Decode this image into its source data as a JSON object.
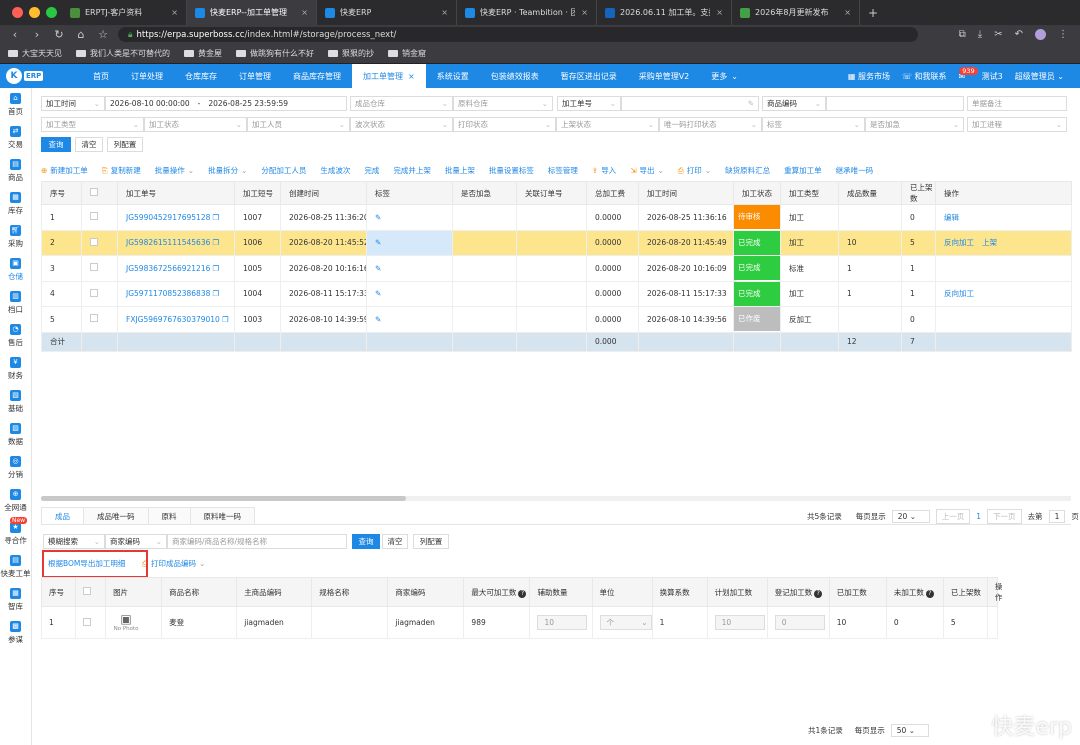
{
  "browser": {
    "tabs": [
      {
        "label": "ERPTJ-客户资料",
        "color": "#4a8f3c",
        "active": false
      },
      {
        "label": "快麦ERP--加工单管理",
        "color": "#1e88e5",
        "active": true
      },
      {
        "label": "快麦ERP",
        "color": "#1e88e5",
        "active": false
      },
      {
        "label": "快麦ERP · Teambition · 团队",
        "color": "#1e88e5",
        "active": false
      },
      {
        "label": "2026.06.11 加工单。支持成品",
        "color": "#1565c0",
        "active": false
      },
      {
        "label": "2026年8月更新发布",
        "color": "#43a047",
        "active": false
      }
    ],
    "url_host": "https://erpa.superboss.cc",
    "url_path": "/index.html#/storage/process_next/",
    "bookmarks": [
      "大宝天天见",
      "我们人类是不可替代的",
      "黄金屋",
      "做跳狗有什么不好",
      "狠狠的抄",
      "销金窟"
    ]
  },
  "appnav": {
    "logo": "K",
    "logo_tag": "ERP",
    "items": [
      "首页",
      "订单处理",
      "仓库库存",
      "订单管理",
      "商品库存管理",
      "加工单管理",
      "系统设置",
      "包装绩效报表",
      "暂存区进出记录",
      "采购单管理V2",
      "更多"
    ],
    "active_index": 5,
    "right": {
      "market": "服务市场",
      "contact": "和我联系",
      "msg_count": "939",
      "user1": "测试3",
      "user2": "超级管理员"
    }
  },
  "sidebar": [
    "首页",
    "交易",
    "商品",
    "库存",
    "采购",
    "仓储",
    "档口",
    "售后",
    "财务",
    "基础",
    "数据",
    "分销",
    "全网通",
    "寻合作",
    "快麦工单",
    "智库",
    "参谋"
  ],
  "sidebar_new": "New",
  "filters": {
    "time_type": "加工时间",
    "date_start": "2026-08-10 00:00:00",
    "date_sep": "-",
    "date_end": "2026-08-25 23:59:59",
    "ph_finished_wh": "成品仓库",
    "ph_raw_wh": "原料仓库",
    "order_no_type": "加工单号",
    "code_type": "商品编码",
    "ph_remark": "单据备注",
    "ph_type": "加工类型",
    "ph_status": "加工状态",
    "ph_worker": "加工人员",
    "ph_wave": "波次状态",
    "ph_print": "打印状态",
    "ph_shelf": "上架状态",
    "ph_unique": "唯一码打印状态",
    "ph_tag": "标签",
    "ph_urgent": "是否加急",
    "ph_progress": "加工进程",
    "btn_query": "查询",
    "btn_clear": "清空",
    "btn_columns": "列配置"
  },
  "actions": [
    "新建加工单",
    "复制新建",
    "批量操作",
    "批量拆分",
    "分配加工人员",
    "生成波次",
    "完成",
    "完成并上架",
    "批量上架",
    "批量设置标签",
    "标签管理",
    "导入",
    "导出",
    "打印",
    "缺货原料汇总",
    "重算加工单",
    "继承唯一码"
  ],
  "main_table": {
    "headers": [
      "序号",
      "",
      "加工单号",
      "加工短号",
      "创建时间",
      "标签",
      "是否加急",
      "关联订单号",
      "总加工费",
      "加工时间",
      "加工状态",
      "加工类型",
      "成品数量",
      "已上架数",
      "操作"
    ],
    "rows": [
      {
        "idx": "1",
        "no": "JG5990452917695128",
        "short": "1007",
        "created": "2026-08-25 11:36:20",
        "fee": "0.0000",
        "ptime": "2026-08-25 11:36:16",
        "status": "待审核",
        "status_color": "#fb8c00",
        "type": "加工",
        "qty": "",
        "shelved": "0",
        "ops": [
          "编辑"
        ]
      },
      {
        "idx": "2",
        "no": "JG5982615111545636",
        "short": "1006",
        "created": "2026-08-20 11:45:52",
        "fee": "0.0000",
        "ptime": "2026-08-20 11:45:49",
        "status": "已完成",
        "status_color": "#2ecc40",
        "type": "加工",
        "qty": "10",
        "shelved": "5",
        "ops": [
          "反向加工",
          "上架"
        ]
      },
      {
        "idx": "3",
        "no": "JG5983672566921216",
        "short": "1005",
        "created": "2026-08-20 10:16:16",
        "fee": "0.0000",
        "ptime": "2026-08-20 10:16:09",
        "status": "已完成",
        "status_color": "#2ecc40",
        "type": "标准",
        "qty": "1",
        "shelved": "1",
        "ops": []
      },
      {
        "idx": "4",
        "no": "JG5971170852386838",
        "short": "1004",
        "created": "2026-08-11 15:17:33",
        "fee": "0.0000",
        "ptime": "2026-08-11 15:17:33",
        "status": "已完成",
        "status_color": "#2ecc40",
        "type": "加工",
        "qty": "1",
        "shelved": "1",
        "ops": [
          "反向加工"
        ]
      },
      {
        "idx": "5",
        "no": "FXJG5969767630379010",
        "short": "1003",
        "created": "2026-08-10 14:39:59",
        "fee": "0.0000",
        "ptime": "2026-08-10 14:39:56",
        "status": "已作废",
        "status_color": "#bdbdbd",
        "type": "反加工",
        "qty": "",
        "shelved": "0",
        "ops": []
      }
    ],
    "total_label": "合计",
    "total_fee": "0.000",
    "total_qty": "12",
    "total_shelved": "7"
  },
  "sub": {
    "tabs": [
      "成品",
      "成品唯一码",
      "原料",
      "原料唯一码"
    ],
    "pager": {
      "total": "共5条记录",
      "per_page_label": "每页显示",
      "per_page": "20",
      "prev": "上一页",
      "page": "1",
      "next": "下一页",
      "goto": "去第",
      "goto_val": "1",
      "goto_suffix": "页"
    },
    "search_mode": "模糊搜索",
    "search_field": "商家编码",
    "search_ph": "商家编码/商品名称/规格名称",
    "btn_query": "查询",
    "btn_clear": "清空",
    "btn_columns": "列配置",
    "export_bom": "根据BOM导出加工明细",
    "print_code": "打印成品编码",
    "headers": [
      "序号",
      "",
      "图片",
      "商品名称",
      "主商品编码",
      "规格名称",
      "商家编码",
      "最大可加工数",
      "辅助数量",
      "单位",
      "换算系数",
      "计划加工数",
      "登记加工数",
      "已加工数",
      "未加工数",
      "已上架数",
      "操作"
    ],
    "row": {
      "idx": "1",
      "photo": "No Photo",
      "name": "麦登",
      "main_code": "jiagmaden",
      "spec": "",
      "code": "jiagmaden",
      "max": "989",
      "aux": "10",
      "unit": "个",
      "ratio": "1",
      "plan": "10",
      "reg": "0",
      "done": "10",
      "undone": "0",
      "shelved": "5"
    },
    "footer": {
      "total": "共1条记录",
      "per_page_label": "每页显示",
      "per_page": "50"
    }
  },
  "watermark": "快麦erp"
}
